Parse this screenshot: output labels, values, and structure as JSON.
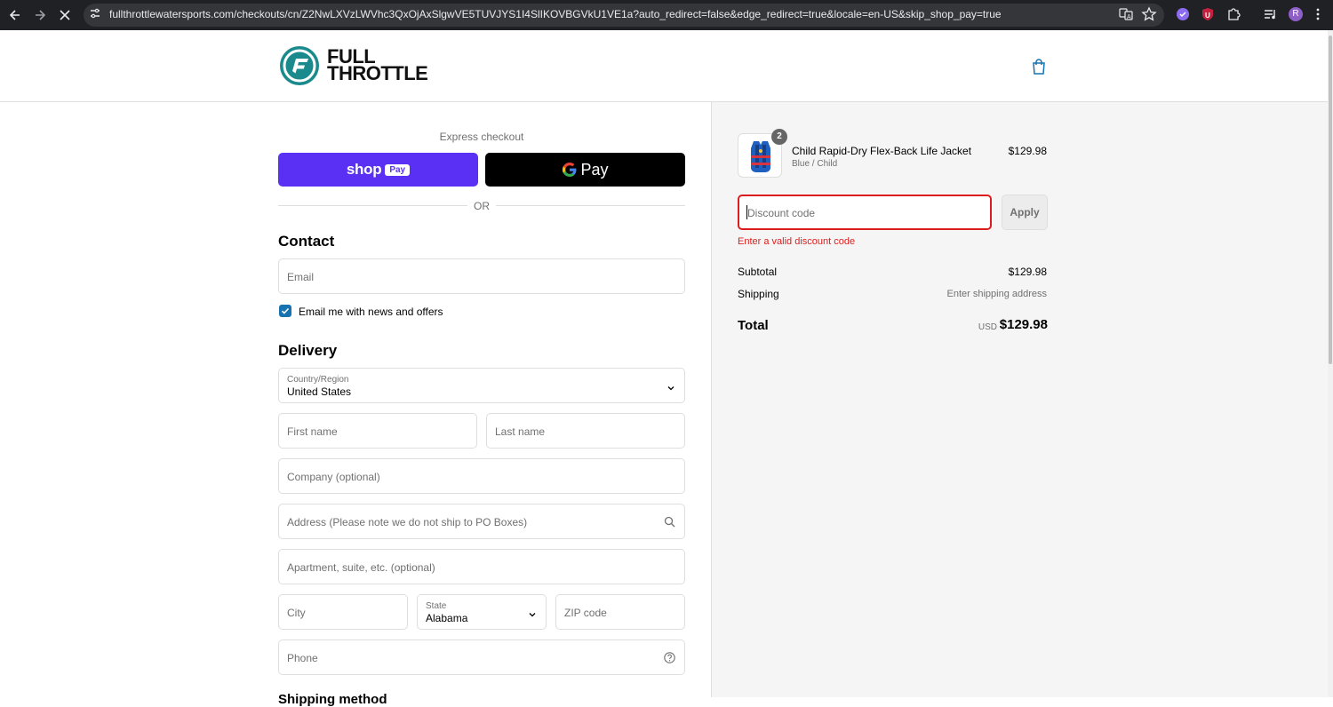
{
  "browser": {
    "url": "fullthrottlewatersports.com/checkouts/cn/Z2NwLXVzLWVhc3QxOjAxSlgwVE5TUVJYS1I4SlIKOVBGVkU1VE1a?auto_redirect=false&edge_redirect=true&locale=en-US&skip_shop_pay=true",
    "icons": [
      "back-icon",
      "forward-icon",
      "loading-stop-icon",
      "site-info-icon",
      "translate-icon",
      "bookmark-star-icon",
      "extension-icon",
      "shield-extension-icon",
      "puzzle-extensions-icon",
      "media-icon",
      "profile-avatar",
      "more-menu-icon"
    ],
    "avatar_letter": "R"
  },
  "header": {
    "logo_line1": "FULL",
    "logo_line2": "THROTTLE",
    "brand_color": "#1a8a8c"
  },
  "express": {
    "label": "Express checkout",
    "shop_pay_word": "shop",
    "shop_pay_badge": "Pay",
    "gpay_word": "Pay",
    "or_text": "OR"
  },
  "contact": {
    "title": "Contact",
    "email_placeholder": "Email",
    "newsletter_label": "Email me with news and offers",
    "newsletter_checked": true
  },
  "delivery": {
    "title": "Delivery",
    "country_label": "Country/Region",
    "country_value": "United States",
    "first_name_placeholder": "First name",
    "last_name_placeholder": "Last name",
    "company_placeholder": "Company (optional)",
    "address_placeholder": "Address (Please note we do not ship to PO Boxes)",
    "apartment_placeholder": "Apartment, suite, etc. (optional)",
    "city_placeholder": "City",
    "state_label": "State",
    "state_value": "Alabama",
    "zip_placeholder": "ZIP code",
    "phone_placeholder": "Phone",
    "next_section_partial": "Shipping method"
  },
  "summary": {
    "product": {
      "name": "Child Rapid-Dry Flex-Back Life Jacket",
      "variant": "Blue / Child",
      "price": "$129.98",
      "quantity": "2"
    },
    "discount": {
      "placeholder": "Discount code",
      "apply_label": "Apply",
      "error": "Enter a valid discount code"
    },
    "subtotal_label": "Subtotal",
    "subtotal_value": "$129.98",
    "shipping_label": "Shipping",
    "shipping_value": "Enter shipping address",
    "total_label": "Total",
    "total_currency": "USD",
    "total_value": "$129.98"
  },
  "colors": {
    "shop_pay": "#5a31f4",
    "checkbox": "#1773b0",
    "error": "#dd1d1d"
  }
}
